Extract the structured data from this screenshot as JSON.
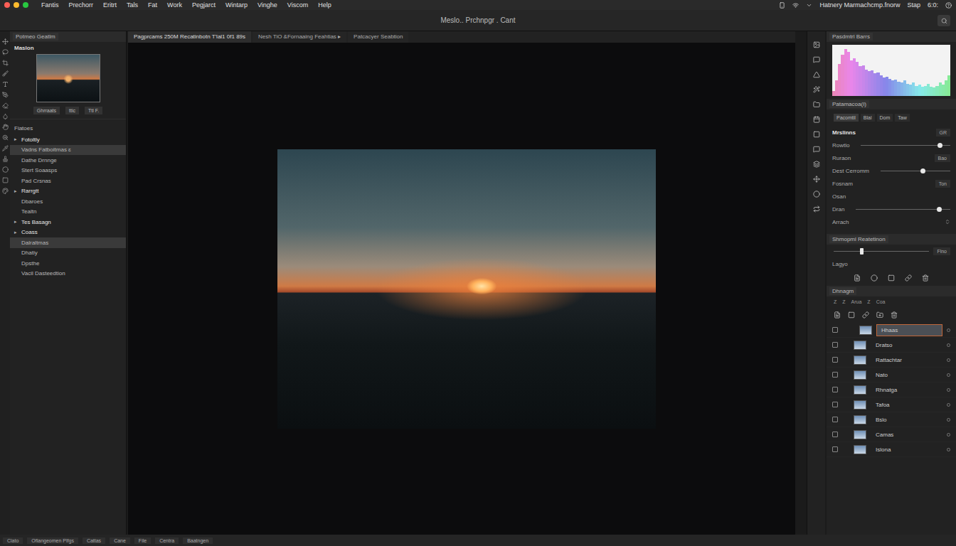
{
  "window": {
    "title": "Meslo.. Prchnpgr . Cant"
  },
  "menubar": {
    "traffic_lights": [
      {
        "color": "#ff5f57"
      },
      {
        "color": "#febc2e"
      },
      {
        "color": "#28c840"
      }
    ],
    "items": [
      "Fantis",
      "Prechorr",
      "Eritrt",
      "Tals",
      "Fat",
      "Work",
      "Pegjarct",
      "Wintarp",
      "Vinghe",
      "Viscom",
      "Help"
    ],
    "status": [
      "Hatnery Marmachcmp.fnorw",
      "Stap",
      "6:0:"
    ]
  },
  "navigator": {
    "tab": "Potmeo Geatlm",
    "title": "Maslon",
    "buttons": [
      "Ghrraats",
      "ttic",
      "Ttl F."
    ]
  },
  "presets": {
    "title": "Fiatoes",
    "items": [
      {
        "label": "Fotoltly",
        "kind": "group",
        "expanded": false,
        "selected": false
      },
      {
        "label": "Vadns Fatboitmas ɛ",
        "kind": "item",
        "expanded": false,
        "selected": true
      },
      {
        "label": "Dathe Drnnge",
        "kind": "item",
        "expanded": false,
        "selected": false
      },
      {
        "label": "Stert Soaasps",
        "kind": "item",
        "expanded": false,
        "selected": false
      },
      {
        "label": "Pad Crsnas",
        "kind": "item",
        "expanded": false,
        "selected": false
      },
      {
        "label": "Rarrgtt",
        "kind": "group",
        "expanded": false,
        "selected": false
      },
      {
        "label": "Dbaroes",
        "kind": "item",
        "expanded": false,
        "selected": false
      },
      {
        "label": "Tealtn",
        "kind": "item",
        "expanded": false,
        "selected": false
      },
      {
        "label": "Tes Basagn",
        "kind": "group",
        "expanded": false,
        "selected": false
      },
      {
        "label": "Coass",
        "kind": "group",
        "expanded": false,
        "selected": false
      },
      {
        "label": "Dalraltmas",
        "kind": "item",
        "expanded": false,
        "selected": true
      },
      {
        "label": "Dhatiy",
        "kind": "item",
        "expanded": false,
        "selected": false
      },
      {
        "label": "Dpsthe",
        "kind": "item",
        "expanded": false,
        "selected": false
      },
      {
        "label": "Vacil Dasteedtion",
        "kind": "item",
        "expanded": false,
        "selected": false
      }
    ]
  },
  "document_tabs": [
    {
      "label": "Pagprcams 250M Recatinbotn T'lal1 0f1 89s",
      "selected": true
    },
    {
      "label": "Nesh TiO &Fornaaing Feahtias ▸",
      "selected": false
    },
    {
      "label": "Patcacyer Seabtion",
      "selected": false
    }
  ],
  "histogram": {
    "title": "Pasdmtrl Barrs",
    "values": [
      10,
      30,
      62,
      80,
      92,
      86,
      70,
      74,
      66,
      58,
      60,
      52,
      48,
      50,
      44,
      46,
      40,
      36,
      38,
      34,
      30,
      32,
      28,
      26,
      30,
      24,
      22,
      26,
      20,
      22,
      18,
      20,
      24,
      18,
      16,
      20,
      26,
      22,
      30,
      40
    ]
  },
  "properties": {
    "tab": "Patamacoa(I)",
    "subtabs": [
      {
        "label": "Pacomtil",
        "selected": true
      },
      {
        "label": "Blal",
        "selected": false
      },
      {
        "label": "Dom",
        "selected": false
      },
      {
        "label": "Taw",
        "selected": false
      }
    ],
    "rows": [
      {
        "label": "Mrslinns",
        "kind": "value",
        "value": "GR",
        "level": 0
      },
      {
        "label": "Rowtlo",
        "kind": "slider",
        "value": "",
        "level": 0.88
      },
      {
        "label": "Ruraon",
        "kind": "value",
        "value": "Bao",
        "level": 0
      },
      {
        "label": "Dest Cerromm",
        "kind": "slider",
        "value": "",
        "level": 0.6
      },
      {
        "label": "Fosnam",
        "kind": "value",
        "value": "Ton",
        "level": 0
      },
      {
        "label": "Osan",
        "kind": "text",
        "value": "",
        "level": 0
      },
      {
        "label": "Dran",
        "kind": "slider",
        "value": "",
        "level": 0.88
      },
      {
        "label": "Arrach",
        "kind": "select",
        "value": "",
        "level": 0
      }
    ]
  },
  "adjustments": {
    "title": "Shmopml Reatetinon",
    "level": 0.3,
    "value": "Flno",
    "label": "Lagyo"
  },
  "layers": {
    "title": "Dhnagm",
    "toolbar": [
      "Z",
      "Z",
      "Arua",
      "Z",
      "Coa"
    ],
    "items": [
      {
        "name": "Hhaas",
        "selected": true,
        "checked": false
      },
      {
        "name": "Dratso",
        "selected": false,
        "checked": false
      },
      {
        "name": "Rattachtar",
        "selected": false,
        "checked": false
      },
      {
        "name": "Nato",
        "selected": false,
        "checked": false
      },
      {
        "name": "Rhnatga",
        "selected": false,
        "checked": false
      },
      {
        "name": "Tafoa",
        "selected": false,
        "checked": false
      },
      {
        "name": "Bslo",
        "selected": false,
        "checked": false
      },
      {
        "name": "Camas",
        "selected": false,
        "checked": false
      },
      {
        "name": "Islona",
        "selected": false,
        "checked": false
      }
    ]
  },
  "status_bar": [
    "Clato",
    "Oflangeomen Plfgs",
    "Cattas",
    "Cane",
    "File",
    "Centra",
    "Baatngen"
  ]
}
